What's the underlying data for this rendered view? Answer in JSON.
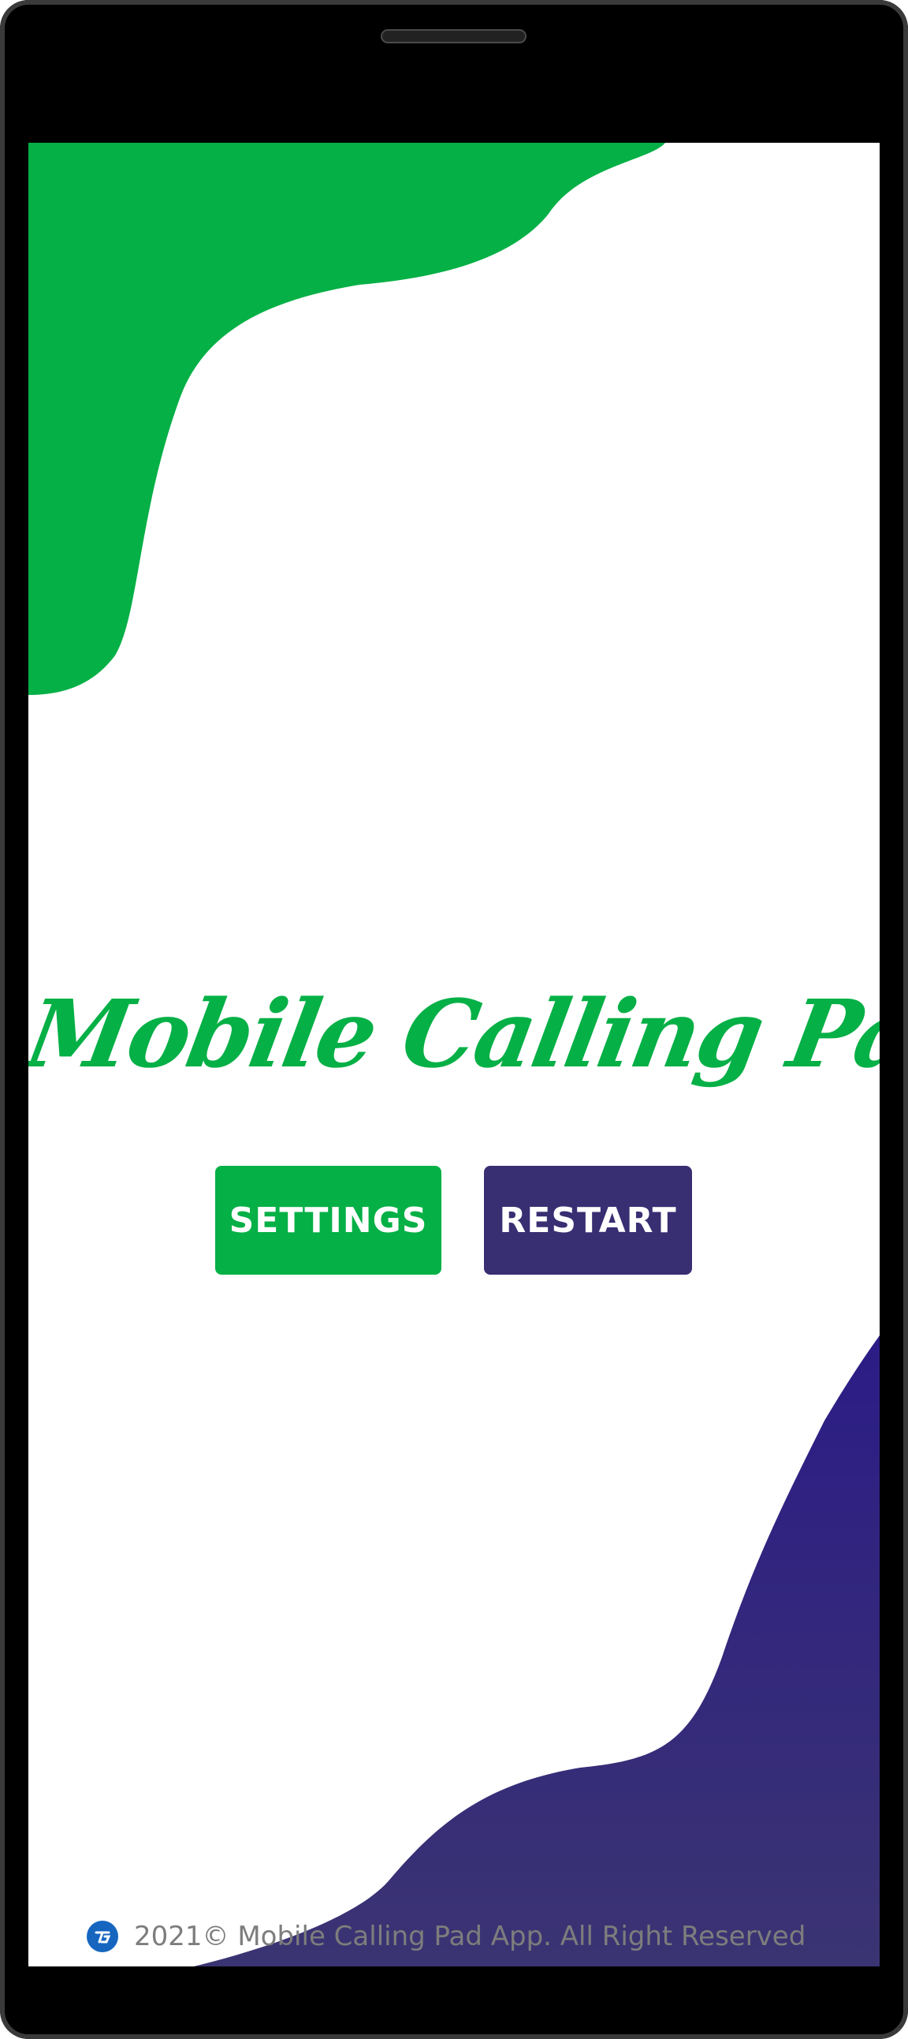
{
  "app": {
    "title": "Mobile Calling Pad"
  },
  "buttons": {
    "settings_label": "SETTINGS",
    "restart_label": "RESTART"
  },
  "footer": {
    "logo_icon": "company-logo-icon",
    "text": "2021© Mobile Calling Pad App. All Right Reserved"
  },
  "colors": {
    "primary_green": "#05b046",
    "primary_purple": "#382e72",
    "footer_text": "#7d7d7d",
    "device_frame": "#000000"
  }
}
